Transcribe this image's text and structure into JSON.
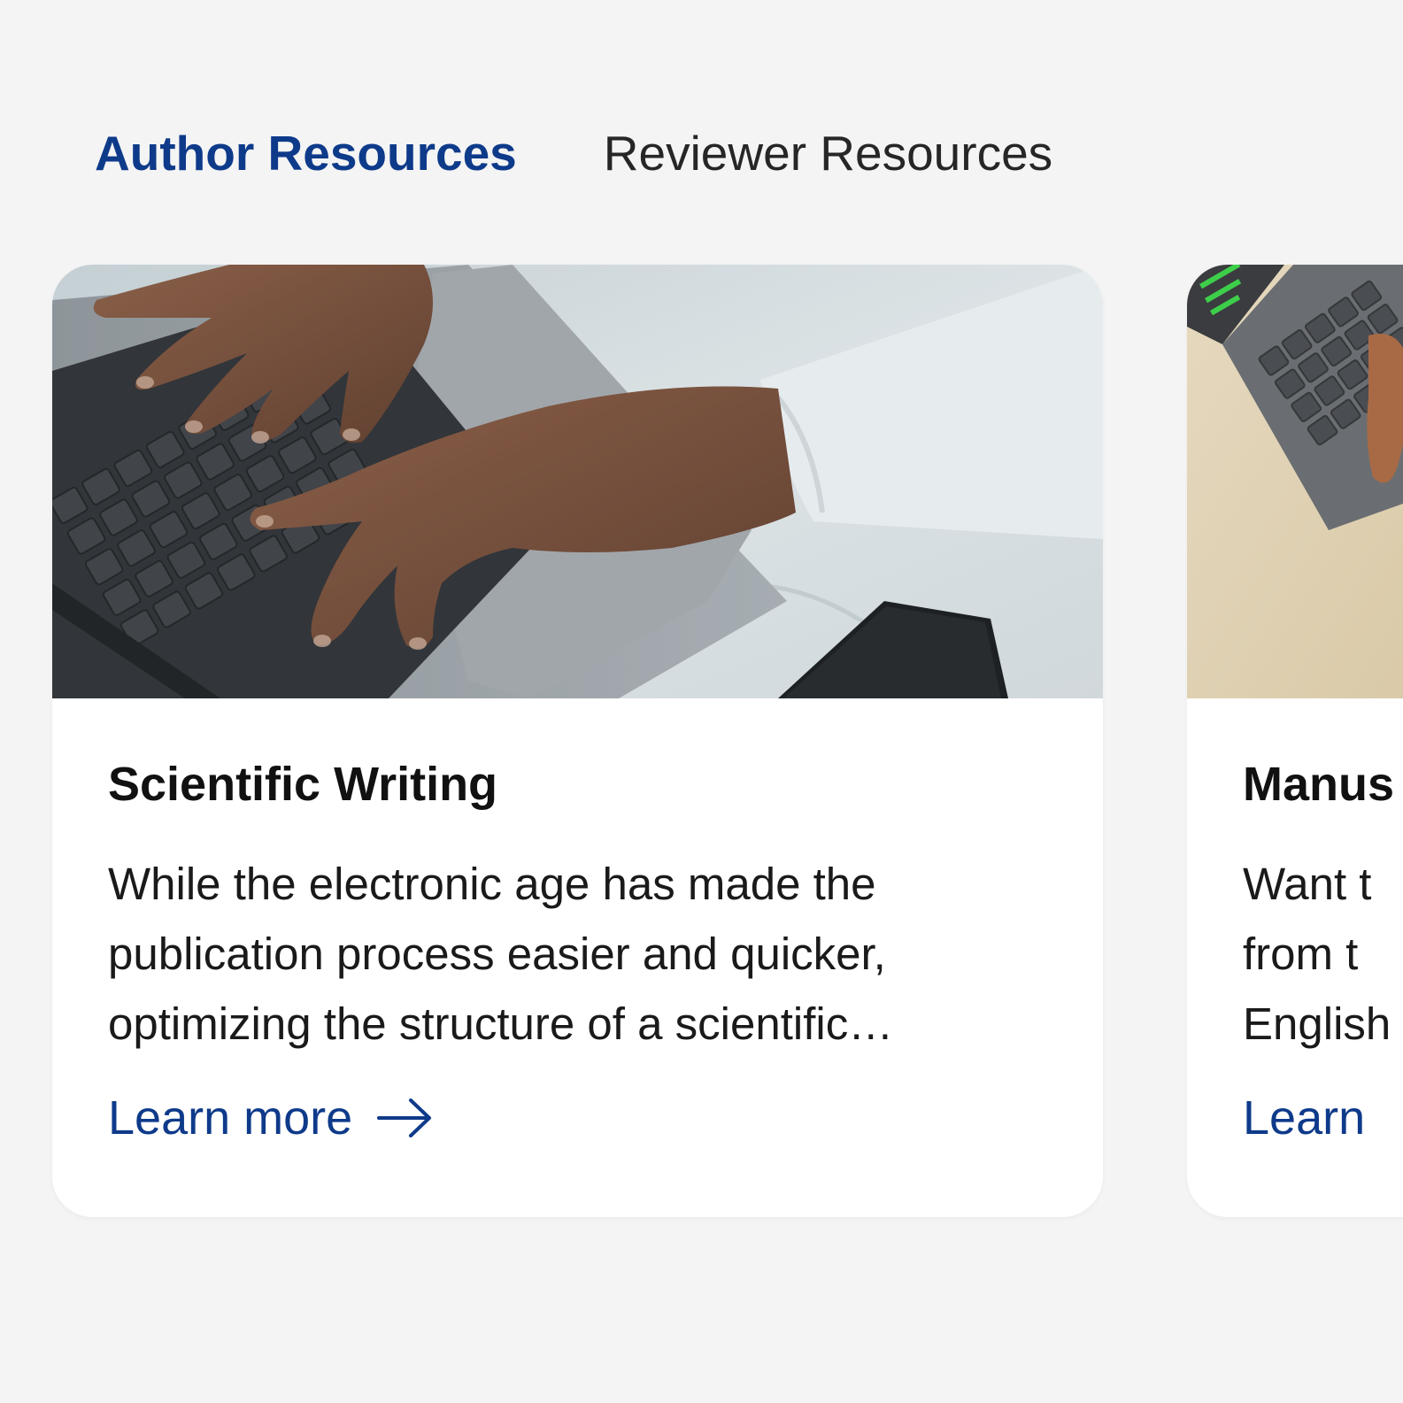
{
  "tabs": [
    {
      "label": "Author Resources",
      "active": true
    },
    {
      "label": "Reviewer Resources",
      "active": false
    }
  ],
  "cards": [
    {
      "title": "Scientific Writing",
      "description": "While the electronic age has made the publication process easier and quicker, optimizing the structure of a scientific…",
      "link_label": "Learn more",
      "image_alt": "hands typing on a laptop keyboard on a white bedsheet"
    },
    {
      "title": "Manus",
      "description": "Want t from t English",
      "link_label": "Learn",
      "image_alt": "person typing on a grey laptop keyboard"
    }
  ],
  "colors": {
    "accent": "#0e3a8a",
    "background": "#f4f4f4",
    "card": "#ffffff"
  }
}
